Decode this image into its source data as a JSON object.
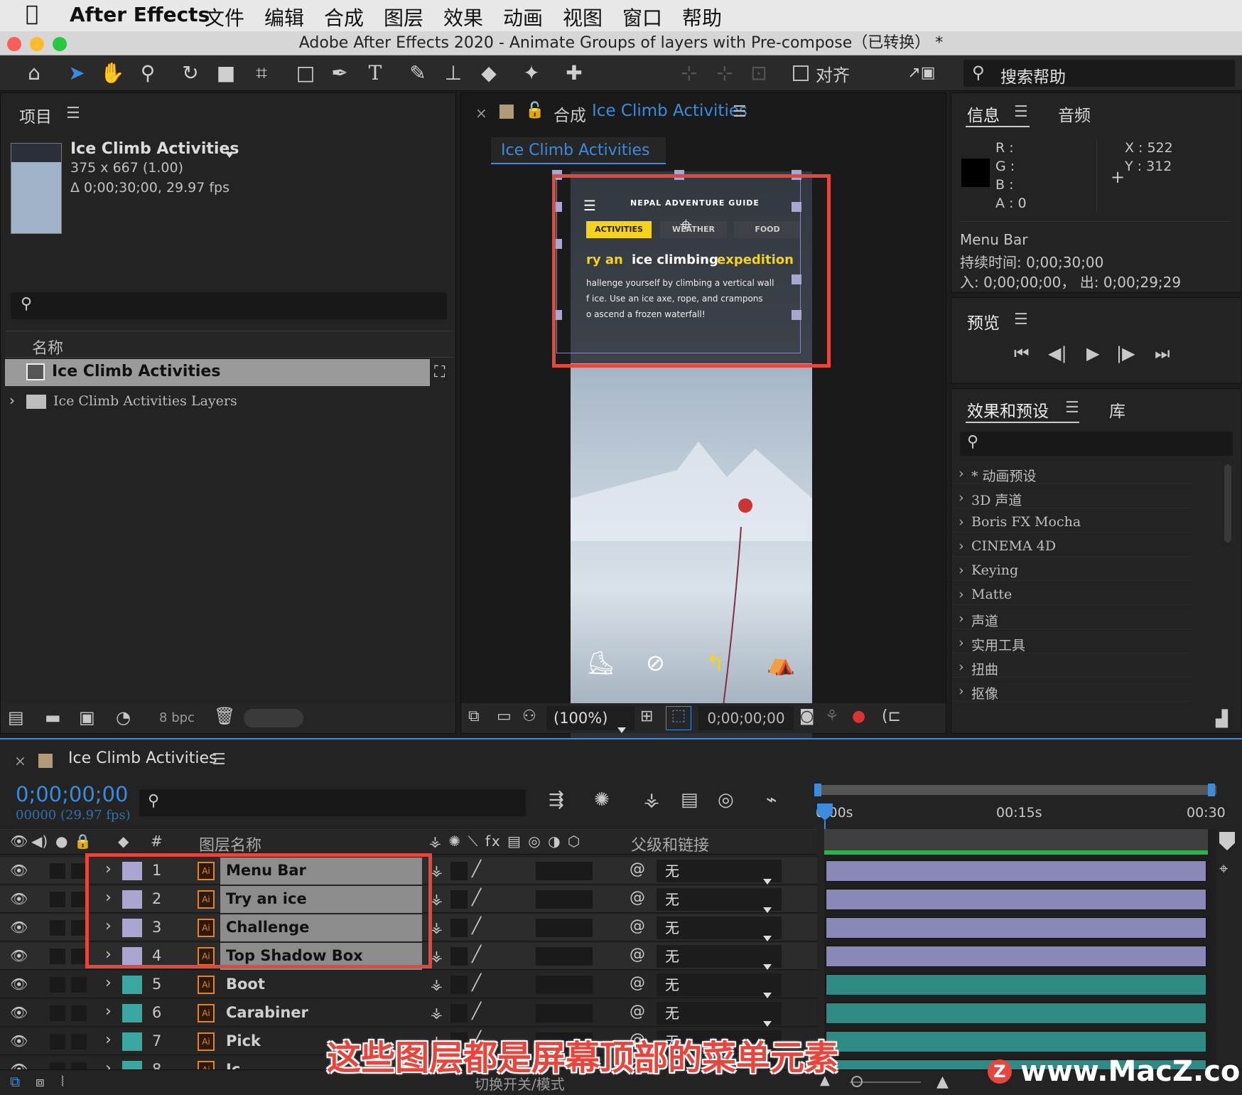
{
  "menubar": {
    "app": "After Effects",
    "items": [
      "文件",
      "编辑",
      "合成",
      "图层",
      "效果",
      "动画",
      "视图",
      "窗口",
      "帮助"
    ]
  },
  "window": {
    "title": "Adobe After Effects 2020 - Animate Groups of layers with Pre-compose（已转换） *"
  },
  "toolbar": {
    "align_label": "对齐",
    "search_help": "搜索帮助"
  },
  "project": {
    "title": "项目",
    "comp_name": "Ice Climb Activities",
    "comp_size": "375 x 667 (1.00)",
    "comp_dur": "Δ 0;00;30;00, 29.97 fps",
    "col_name": "名称",
    "items": [
      {
        "name": "Ice Climb Activities",
        "type": "comp"
      },
      {
        "name": "Ice Climb Activities Layers",
        "type": "folder"
      }
    ],
    "bpc": "8 bpc"
  },
  "comp_viewer": {
    "tab_prefix": "合成",
    "tab_name": "Ice Climb Activities",
    "subtab": "Ice Climb Activities",
    "zoom": "(100%)",
    "timecode": "0;00;00;00"
  },
  "comp_image": {
    "guide_title": "NEPAL ADVENTURE GUIDE",
    "tabs": [
      "ACTIVITIES",
      "WEATHER",
      "FOOD"
    ],
    "headline_a": "ry an",
    "headline_b": "ice climbing",
    "headline_c": "expedition",
    "body_lines": [
      "hallenge yourself by climbing a vertical wall",
      "f ice. Use an ice axe, rope, and crampons",
      "o ascend a frozen waterfall!"
    ]
  },
  "info": {
    "tab_info": "信息",
    "tab_audio": "音频",
    "r": "R :",
    "g": "G :",
    "b": "B :",
    "a": "A :  0",
    "x": "X : 522",
    "y": "Y :  312",
    "layer": "Menu Bar",
    "duration": "持续时间: 0;00;30;00",
    "inout": "入: 0;00;00;00，  出: 0;00;29;29"
  },
  "preview": {
    "title": "预览"
  },
  "effects": {
    "tab_effects": "效果和预设",
    "tab_lib": "库",
    "items": [
      "* 动画预设",
      "3D 声道",
      "Boris FX Mocha",
      "CINEMA 4D",
      "Keying",
      "Matte",
      "声道",
      "实用工具",
      "扭曲",
      "抠像"
    ]
  },
  "timeline": {
    "comp_name": "Ice Climb Activities",
    "timecode": "0;00;00;00",
    "frames": "00000 (29.97 fps)",
    "col_num": "#",
    "col_layername": "图层名称",
    "col_parent": "父级和链接",
    "ruler": [
      "0:00s",
      "00:15s",
      "00:30"
    ],
    "toggle_label": "切换开关/模式",
    "layers": [
      {
        "num": "1",
        "name": "Menu Bar",
        "parent": "无",
        "color": "#a9a6cf"
      },
      {
        "num": "2",
        "name": "Try an ice",
        "parent": "无",
        "color": "#a9a6cf"
      },
      {
        "num": "3",
        "name": "Challenge",
        "parent": "无",
        "color": "#a9a6cf"
      },
      {
        "num": "4",
        "name": "Top Shadow Box",
        "parent": "无",
        "color": "#a9a6cf"
      },
      {
        "num": "5",
        "name": "Boot",
        "parent": "无",
        "color": "#3aa8a0"
      },
      {
        "num": "6",
        "name": "Carabiner",
        "parent": "无",
        "color": "#3aa8a0"
      },
      {
        "num": "7",
        "name": "Pick",
        "parent": "无",
        "color": "#3aa8a0"
      },
      {
        "num": "8",
        "name": "Ic...",
        "parent": "",
        "color": "#3aa8a0"
      }
    ]
  },
  "overlay": {
    "caption": "这些图层都是屏幕顶部的菜单元素",
    "watermark": "www.MacZ.com"
  },
  "colors": {
    "accent_blue": "#3b8bdf",
    "highlight_red": "#e8453c",
    "guide_yellow": "#f4d21e",
    "purple_bar": "#8a88b8",
    "teal_bar": "#2e8a84"
  }
}
